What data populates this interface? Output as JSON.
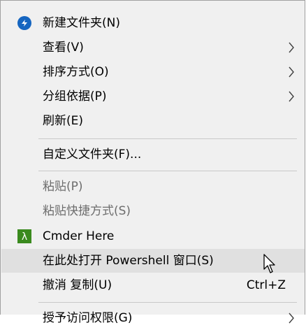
{
  "menu": {
    "items": [
      {
        "label": "新建文件夹(N)",
        "icon": "new-folder-icon",
        "shortcut": "",
        "submenu": false,
        "disabled": false
      },
      {
        "label": "查看(V)",
        "icon": "",
        "shortcut": "",
        "submenu": true,
        "disabled": false
      },
      {
        "label": "排序方式(O)",
        "icon": "",
        "shortcut": "",
        "submenu": true,
        "disabled": false
      },
      {
        "label": "分组依据(P)",
        "icon": "",
        "shortcut": "",
        "submenu": true,
        "disabled": false
      },
      {
        "label": "刷新(E)",
        "icon": "",
        "shortcut": "",
        "submenu": false,
        "disabled": false
      },
      {
        "label": "自定义文件夹(F)...",
        "icon": "",
        "shortcut": "",
        "submenu": false,
        "disabled": false
      },
      {
        "label": "粘贴(P)",
        "icon": "",
        "shortcut": "",
        "submenu": false,
        "disabled": true
      },
      {
        "label": "粘贴快捷方式(S)",
        "icon": "",
        "shortcut": "",
        "submenu": false,
        "disabled": true
      },
      {
        "label": "Cmder Here",
        "icon": "lambda-icon",
        "shortcut": "",
        "submenu": false,
        "disabled": false
      },
      {
        "label": "在此处打开 Powershell 窗口(S)",
        "icon": "",
        "shortcut": "",
        "submenu": false,
        "disabled": false,
        "hovered": true
      },
      {
        "label": "撤消 复制(U)",
        "icon": "",
        "shortcut": "Ctrl+Z",
        "submenu": false,
        "disabled": false
      },
      {
        "label": "授予访问权限(G)",
        "icon": "",
        "shortcut": "",
        "submenu": true,
        "disabled": false
      }
    ]
  },
  "colors": {
    "menu_bg": "#f0f0f0",
    "hover_bg": "#e0e0e0",
    "text": "#000000",
    "disabled_text": "#6d6d6d",
    "new_folder_icon_bg": "#1565c0",
    "lambda_icon_bg": "#3a8a1e"
  },
  "cursor": {
    "icon": "arrow-cursor-icon"
  }
}
